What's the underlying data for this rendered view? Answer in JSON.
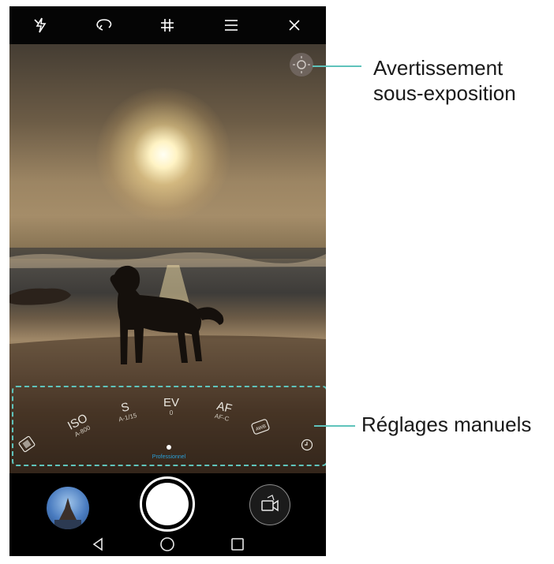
{
  "top_bar": {
    "icons": [
      "flash-off-icon",
      "panorama-icon",
      "grid-icon",
      "menu-icon",
      "close-icon"
    ]
  },
  "manual_controls": {
    "iso": {
      "name": "ISO",
      "value": "A-800"
    },
    "shutter": {
      "name": "S",
      "value": "A-1/15"
    },
    "ev": {
      "name": "EV",
      "value": "0"
    },
    "af": {
      "name": "AF",
      "value": "AF-C"
    },
    "wb_icon": "white-balance-icon",
    "metering_icon": "metering-icon",
    "timer_icon": "timer-icon",
    "mode_label": "Professionnel"
  },
  "bottom": {
    "icons": [
      "gallery-thumbnail",
      "shutter-button",
      "video-switch-icon"
    ]
  },
  "nav": {
    "icons": [
      "back-icon",
      "home-icon",
      "recents-icon"
    ]
  },
  "callouts": {
    "warning_line1": "Avertissement",
    "warning_line2": "sous-exposition",
    "manual": "Réglages manuels"
  },
  "colors": {
    "callout_line": "#5fc3bb",
    "mode_label": "#2a9fd8"
  }
}
